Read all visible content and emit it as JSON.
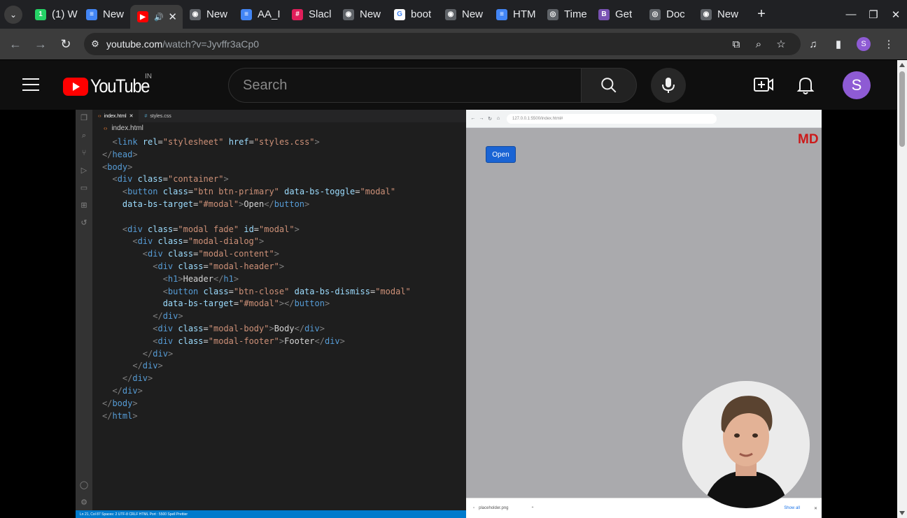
{
  "browser": {
    "tabs": [
      {
        "label": "(1) W",
        "fav_color": "#25d366",
        "fav_glyph": "1"
      },
      {
        "label": "New",
        "fav_color": "#4285f4",
        "fav_glyph": "≡"
      },
      {
        "label": "",
        "fav_color": "#ff0000",
        "fav_glyph": "▶",
        "active": true
      },
      {
        "label": "New",
        "fav_color": "#5f6368",
        "fav_glyph": "◉"
      },
      {
        "label": "AA_I",
        "fav_color": "#4285f4",
        "fav_glyph": "≡"
      },
      {
        "label": "Slacl",
        "fav_color": "#e01e5a",
        "fav_glyph": "#"
      },
      {
        "label": "New",
        "fav_color": "#5f6368",
        "fav_glyph": "◉"
      },
      {
        "label": "boot",
        "fav_color": "#ffffff",
        "fav_glyph": "G"
      },
      {
        "label": "New",
        "fav_color": "#5f6368",
        "fav_glyph": "◉"
      },
      {
        "label": "HTM",
        "fav_color": "#4285f4",
        "fav_glyph": "≡"
      },
      {
        "label": "Time",
        "fav_color": "#5f6368",
        "fav_glyph": "◎"
      },
      {
        "label": "Get",
        "fav_color": "#7952b3",
        "fav_glyph": "B"
      },
      {
        "label": "Doc",
        "fav_color": "#5f6368",
        "fav_glyph": "◎"
      },
      {
        "label": "New",
        "fav_color": "#5f6368",
        "fav_glyph": "◉"
      }
    ],
    "url_host": "youtube.com",
    "url_path": "/watch?v=Jyvffr3aCp0",
    "profile_initial": "S"
  },
  "youtube": {
    "region": "IN",
    "logo_text": "YouTube",
    "search_placeholder": "Search",
    "avatar_initial": "S"
  },
  "video": {
    "editor_tabs": [
      "index.html",
      "styles.css"
    ],
    "breadcrumb": "index.html",
    "preview_button": "Open",
    "preview_brand": "MD",
    "download_file": "placeholder.png",
    "download_show_all": "Show all",
    "preview_url": "127.0.0.1:5500/index.html#",
    "statusbar": "Ln 21, Col 87   Spaces: 2   UTF-8   CRLF   HTML   Port : 5500   Spell   Prettier"
  },
  "colors": {
    "youtube_red": "#ff0000",
    "avatar": "#8e5bd4",
    "vscode_blue": "#007acc",
    "bootstrap_primary": "#1a64d4"
  }
}
